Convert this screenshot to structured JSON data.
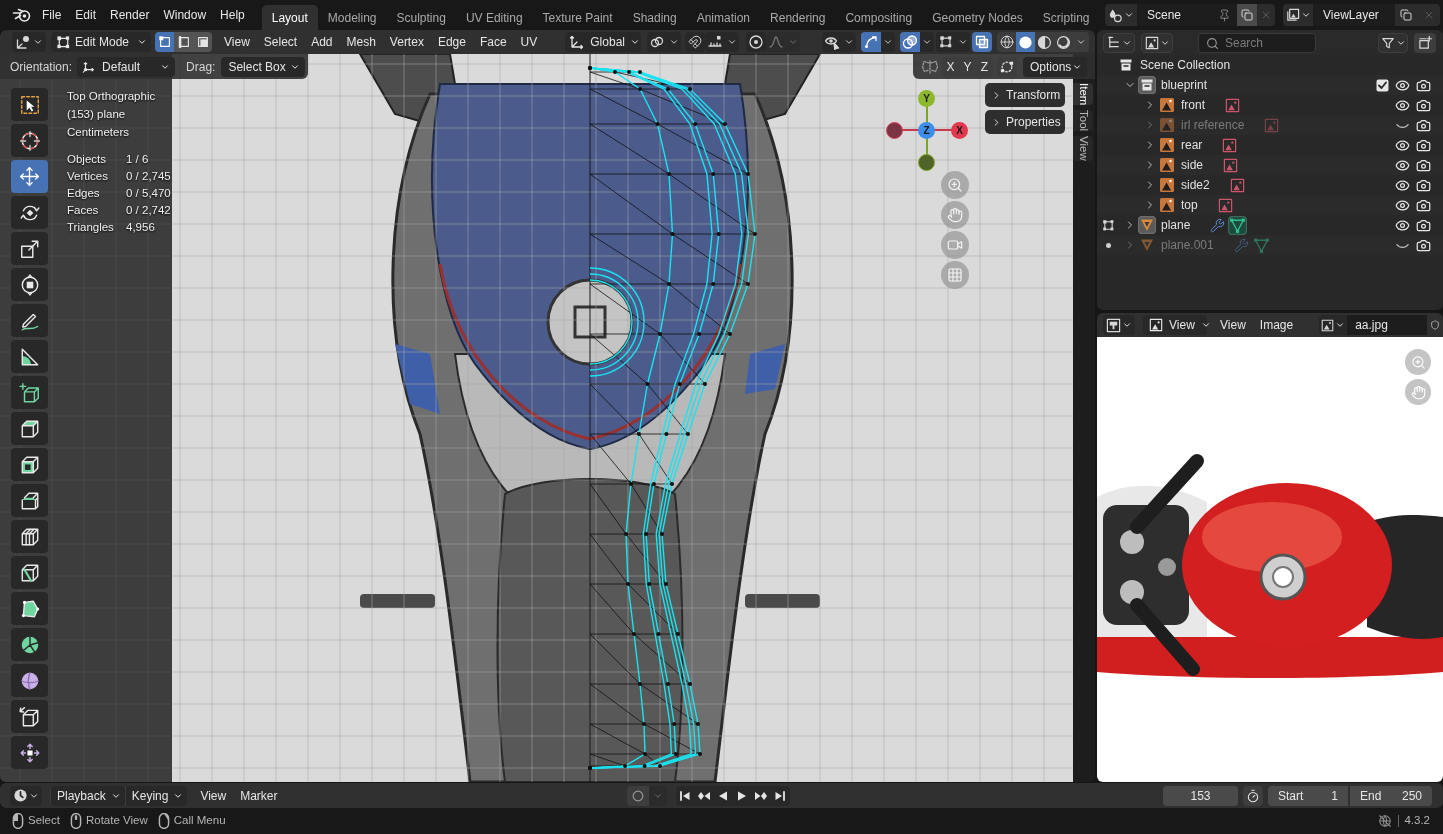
{
  "top_bar": {
    "menus": [
      "File",
      "Edit",
      "Render",
      "Window",
      "Help"
    ],
    "workspaces": [
      {
        "label": "Layout",
        "selected": true
      },
      {
        "label": "Modeling",
        "selected": false
      },
      {
        "label": "Sculpting",
        "selected": false
      },
      {
        "label": "UV Editing",
        "selected": false
      },
      {
        "label": "Texture Paint",
        "selected": false
      },
      {
        "label": "Shading",
        "selected": false
      },
      {
        "label": "Animation",
        "selected": false
      },
      {
        "label": "Rendering",
        "selected": false
      },
      {
        "label": "Compositing",
        "selected": false
      },
      {
        "label": "Geometry Nodes",
        "selected": false
      },
      {
        "label": "Scripting",
        "selected": false
      }
    ],
    "scene": "Scene",
    "view_layer": "ViewLayer"
  },
  "viewport": {
    "header": {
      "mode": "Edit Mode",
      "select_modes": [
        {
          "kind": "vertex",
          "selected": true
        },
        {
          "kind": "edge",
          "selected": false
        },
        {
          "kind": "face",
          "selected": false
        }
      ],
      "menus": [
        "View",
        "Select",
        "Add",
        "Mesh",
        "Vertex",
        "Edge",
        "Face",
        "UV"
      ],
      "orientation": "Global",
      "controls": [
        {
          "kind": "pivot",
          "on": false,
          "disabled": false
        },
        {
          "kind": "snap",
          "on": false,
          "disabled": false
        },
        {
          "kind": "snap_target",
          "on": false,
          "disabled": false
        },
        {
          "kind": "proportional",
          "on": false,
          "disabled": false
        },
        {
          "kind": "falloff",
          "on": false,
          "disabled": true
        },
        {
          "kind": "selectability",
          "on": false,
          "disabled": false
        },
        {
          "kind": "gizmos",
          "on": true,
          "disabled": false
        },
        {
          "kind": "overlays",
          "on": true,
          "disabled": false
        },
        {
          "kind": "mesh_overlays",
          "on": false,
          "disabled": false
        },
        {
          "kind": "xray",
          "on": true,
          "disabled": false
        }
      ],
      "shading": [
        {
          "kind": "wireframe",
          "selected": false
        },
        {
          "kind": "solid",
          "selected": true
        },
        {
          "kind": "material",
          "selected": false
        },
        {
          "kind": "rendered",
          "selected": false
        }
      ]
    },
    "tool_settings": {
      "orientation_label": "Orientation:",
      "orientation": "Default",
      "drag_label": "Drag:",
      "drag": "Select Box",
      "mirror_axes": [
        {
          "label": "X",
          "on": false
        },
        {
          "label": "Y",
          "on": false
        },
        {
          "label": "Z",
          "on": false
        }
      ],
      "options": "Options"
    },
    "toolbar": [
      {
        "kind": "select_box",
        "selected": false
      },
      {
        "kind": "cursor",
        "selected": false
      },
      {
        "kind": "move",
        "selected": true
      },
      {
        "kind": "rotate",
        "selected": false
      },
      {
        "kind": "scale",
        "selected": false
      },
      {
        "kind": "transform",
        "selected": false
      },
      {
        "kind": "annotate",
        "selected": false
      },
      {
        "kind": "measure",
        "selected": false
      },
      {
        "kind": "add_cube",
        "selected": false
      },
      {
        "kind": "extrude",
        "selected": false
      },
      {
        "kind": "inset",
        "selected": false
      },
      {
        "kind": "bevel",
        "selected": false
      },
      {
        "kind": "loop_cut",
        "selected": false
      },
      {
        "kind": "knife",
        "selected": false
      },
      {
        "kind": "poly_build",
        "selected": false
      },
      {
        "kind": "spin",
        "selected": false
      },
      {
        "kind": "smooth",
        "selected": false
      },
      {
        "kind": "edge_slide",
        "selected": false
      },
      {
        "kind": "shrink_fatten",
        "selected": false
      }
    ],
    "overlay_info": {
      "lines": [
        "Top Orthographic",
        "(153) plane",
        "Centimeters"
      ],
      "stats": [
        {
          "label": "Objects",
          "value": "1 / 6"
        },
        {
          "label": "Vertices",
          "value": "0 / 2,745"
        },
        {
          "label": "Edges",
          "value": "0 / 5,470"
        },
        {
          "label": "Faces",
          "value": "0 / 2,742"
        },
        {
          "label": "Triangles",
          "value": "4,956"
        }
      ]
    },
    "gizmo_axes": [
      {
        "kind": "y",
        "label": "Y"
      },
      {
        "kind": "z",
        "label": "Z"
      },
      {
        "kind": "x",
        "label": "X"
      }
    ],
    "sidebar_panels": [
      {
        "label": "Transform",
        "expanded": false
      },
      {
        "label": "Properties",
        "expanded": false
      }
    ],
    "sidebar_tabs": [
      {
        "label": "Item",
        "selected": true
      },
      {
        "label": "Tool",
        "selected": false
      },
      {
        "label": "View",
        "selected": false
      }
    ]
  },
  "outliner": {
    "search": {
      "placeholder": "Search"
    },
    "tree": [
      {
        "label": "Scene Collection",
        "kind": "scene_collection",
        "children": [
          {
            "label": "blueprint",
            "kind": "collection",
            "expanded": true,
            "active": true,
            "checked": true,
            "visible": true,
            "children": [
              {
                "label": "front",
                "kind": "image",
                "expanded": false,
                "active": false,
                "visible": true
              },
              {
                "label": "irl reference",
                "kind": "image",
                "expanded": false,
                "active": false,
                "visible": false
              },
              {
                "label": "rear",
                "kind": "image",
                "expanded": false,
                "active": false,
                "visible": true
              },
              {
                "label": "side",
                "kind": "image",
                "expanded": false,
                "active": false,
                "visible": true
              },
              {
                "label": "side2",
                "kind": "image",
                "expanded": false,
                "active": false,
                "visible": true
              },
              {
                "label": "top",
                "kind": "image",
                "expanded": false,
                "active": false,
                "visible": true
              }
            ]
          },
          {
            "label": "plane",
            "kind": "mesh",
            "expanded": false,
            "active": true,
            "visible": true,
            "edit_mode": true
          },
          {
            "label": "plane.001",
            "kind": "mesh",
            "expanded": false,
            "active": false,
            "visible": false,
            "edit_mode": false
          }
        ]
      }
    ]
  },
  "image_editor": {
    "mode": "View",
    "menus": [
      "View",
      "Image"
    ],
    "image": "aa.jpg"
  },
  "timeline": {
    "menus": [
      {
        "label": "Playback",
        "kind": "dropdown"
      },
      {
        "label": "Keying",
        "kind": "dropdown"
      },
      {
        "label": "View",
        "kind": "menu"
      },
      {
        "label": "Marker",
        "kind": "menu"
      }
    ],
    "auto_keying": false,
    "current_frame": "153",
    "start": {
      "label": "Start",
      "value": "1"
    },
    "end": {
      "label": "End",
      "value": "250"
    }
  },
  "status_bar": {
    "hints": [
      {
        "kind": "left_click",
        "label": "Select"
      },
      {
        "kind": "middle_click",
        "label": "Rotate View"
      },
      {
        "kind": "right_click",
        "label": "Call Menu"
      }
    ],
    "version": "4.3.2"
  }
}
